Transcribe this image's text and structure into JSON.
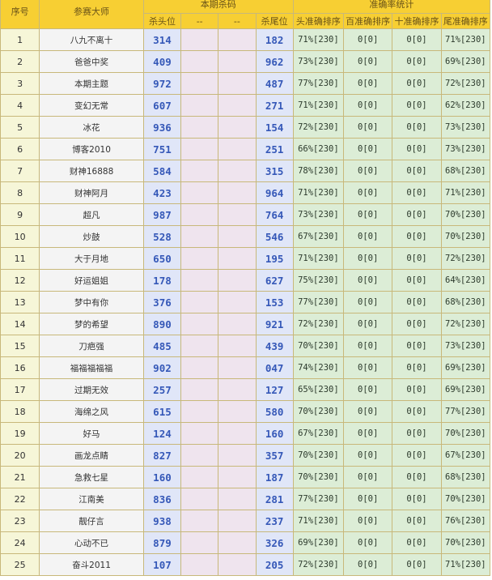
{
  "header": {
    "index": "序号",
    "expert": "参赛大师",
    "group_kill": "本期杀码",
    "group_stats": "准确率统计",
    "kill_head": "杀头位",
    "dash1": "--",
    "dash2": "--",
    "kill_tail": "杀尾位",
    "stat1": "头准确排序",
    "stat2": "百准确排序",
    "stat3": "十准确排序",
    "stat4": "尾准确排序"
  },
  "rows": [
    {
      "idx": "1",
      "name": "八九不离十",
      "head": "314",
      "tail": "182",
      "s1": "71%[230]",
      "s2": "0[0]",
      "s3": "0[0]",
      "s4": "71%[230]"
    },
    {
      "idx": "2",
      "name": "爸爸中奖",
      "head": "409",
      "tail": "962",
      "s1": "73%[230]",
      "s2": "0[0]",
      "s3": "0[0]",
      "s4": "69%[230]"
    },
    {
      "idx": "3",
      "name": "本期主题",
      "head": "972",
      "tail": "487",
      "s1": "77%[230]",
      "s2": "0[0]",
      "s3": "0[0]",
      "s4": "72%[230]"
    },
    {
      "idx": "4",
      "name": "变幻无常",
      "head": "607",
      "tail": "271",
      "s1": "71%[230]",
      "s2": "0[0]",
      "s3": "0[0]",
      "s4": "62%[230]"
    },
    {
      "idx": "5",
      "name": "冰花",
      "head": "936",
      "tail": "154",
      "s1": "72%[230]",
      "s2": "0[0]",
      "s3": "0[0]",
      "s4": "73%[230]"
    },
    {
      "idx": "6",
      "name": "博客2010",
      "head": "751",
      "tail": "251",
      "s1": "66%[230]",
      "s2": "0[0]",
      "s3": "0[0]",
      "s4": "73%[230]"
    },
    {
      "idx": "7",
      "name": "财神16888",
      "head": "584",
      "tail": "315",
      "s1": "78%[230]",
      "s2": "0[0]",
      "s3": "0[0]",
      "s4": "68%[230]"
    },
    {
      "idx": "8",
      "name": "财神阿月",
      "head": "423",
      "tail": "964",
      "s1": "71%[230]",
      "s2": "0[0]",
      "s3": "0[0]",
      "s4": "71%[230]"
    },
    {
      "idx": "9",
      "name": "超凡",
      "head": "987",
      "tail": "764",
      "s1": "73%[230]",
      "s2": "0[0]",
      "s3": "0[0]",
      "s4": "70%[230]"
    },
    {
      "idx": "10",
      "name": "炒鼓",
      "head": "528",
      "tail": "546",
      "s1": "67%[230]",
      "s2": "0[0]",
      "s3": "0[0]",
      "s4": "70%[230]"
    },
    {
      "idx": "11",
      "name": "大于月地",
      "head": "650",
      "tail": "195",
      "s1": "71%[230]",
      "s2": "0[0]",
      "s3": "0[0]",
      "s4": "72%[230]"
    },
    {
      "idx": "12",
      "name": "好运姐姐",
      "head": "178",
      "tail": "627",
      "s1": "75%[230]",
      "s2": "0[0]",
      "s3": "0[0]",
      "s4": "64%[230]"
    },
    {
      "idx": "13",
      "name": "梦中有你",
      "head": "376",
      "tail": "153",
      "s1": "77%[230]",
      "s2": "0[0]",
      "s3": "0[0]",
      "s4": "68%[230]"
    },
    {
      "idx": "14",
      "name": "梦的希望",
      "head": "890",
      "tail": "921",
      "s1": "72%[230]",
      "s2": "0[0]",
      "s3": "0[0]",
      "s4": "72%[230]"
    },
    {
      "idx": "15",
      "name": "刀疤强",
      "head": "485",
      "tail": "439",
      "s1": "70%[230]",
      "s2": "0[0]",
      "s3": "0[0]",
      "s4": "73%[230]"
    },
    {
      "idx": "16",
      "name": "福福福福福",
      "head": "902",
      "tail": "047",
      "s1": "74%[230]",
      "s2": "0[0]",
      "s3": "0[0]",
      "s4": "69%[230]"
    },
    {
      "idx": "17",
      "name": "过期无效",
      "head": "257",
      "tail": "127",
      "s1": "65%[230]",
      "s2": "0[0]",
      "s3": "0[0]",
      "s4": "69%[230]"
    },
    {
      "idx": "18",
      "name": "海绵之风",
      "head": "615",
      "tail": "580",
      "s1": "70%[230]",
      "s2": "0[0]",
      "s3": "0[0]",
      "s4": "77%[230]"
    },
    {
      "idx": "19",
      "name": "好马",
      "head": "124",
      "tail": "160",
      "s1": "67%[230]",
      "s2": "0[0]",
      "s3": "0[0]",
      "s4": "70%[230]"
    },
    {
      "idx": "20",
      "name": "画龙点睛",
      "head": "827",
      "tail": "357",
      "s1": "70%[230]",
      "s2": "0[0]",
      "s3": "0[0]",
      "s4": "67%[230]"
    },
    {
      "idx": "21",
      "name": "急救七星",
      "head": "160",
      "tail": "187",
      "s1": "70%[230]",
      "s2": "0[0]",
      "s3": "0[0]",
      "s4": "68%[230]"
    },
    {
      "idx": "22",
      "name": "江南美",
      "head": "836",
      "tail": "281",
      "s1": "77%[230]",
      "s2": "0[0]",
      "s3": "0[0]",
      "s4": "70%[230]"
    },
    {
      "idx": "23",
      "name": "靓仔言",
      "head": "938",
      "tail": "237",
      "s1": "71%[230]",
      "s2": "0[0]",
      "s3": "0[0]",
      "s4": "76%[230]"
    },
    {
      "idx": "24",
      "name": "心动不已",
      "head": "879",
      "tail": "326",
      "s1": "69%[230]",
      "s2": "0[0]",
      "s3": "0[0]",
      "s4": "70%[230]"
    },
    {
      "idx": "25",
      "name": "奋斗2011",
      "head": "107",
      "tail": "205",
      "s1": "72%[230]",
      "s2": "0[0]",
      "s3": "0[0]",
      "s4": "71%[230]"
    }
  ]
}
